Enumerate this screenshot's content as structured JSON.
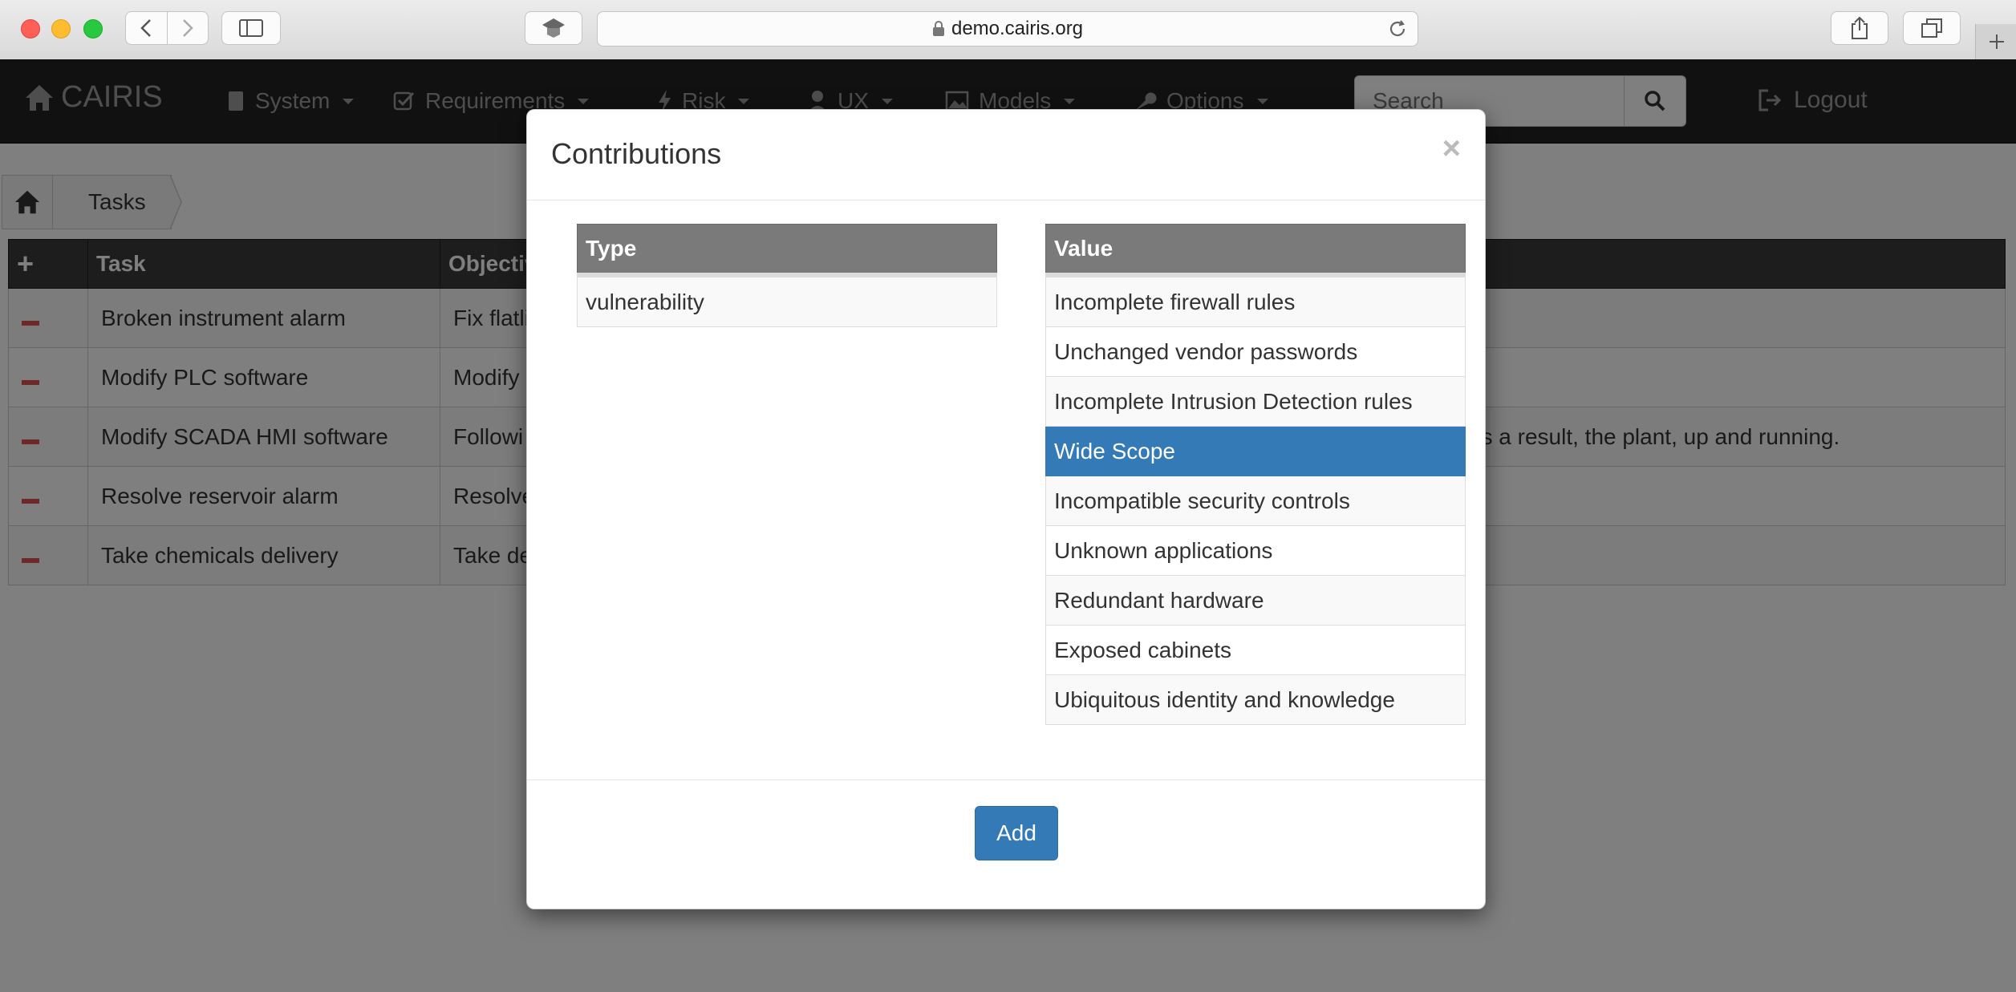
{
  "browser": {
    "url": "demo.cairis.org"
  },
  "navbar": {
    "brand": "CAIRIS",
    "menus": [
      "System",
      "Requirements",
      "Risk",
      "UX",
      "Models",
      "Options"
    ],
    "search_placeholder": "Search",
    "logout": "Logout"
  },
  "breadcrumb": {
    "current": "Tasks"
  },
  "tasks_table": {
    "headers": [
      "Task",
      "Objective"
    ],
    "rows": [
      {
        "task": "Broken instrument alarm",
        "objective": "Fix flatli"
      },
      {
        "task": "Modify PLC software",
        "objective": "Modify"
      },
      {
        "task": "Modify SCADA HMI software",
        "objective": "Followi",
        "objective_tail": "s a result, the plant, up and running."
      },
      {
        "task": "Resolve reservoir alarm",
        "objective": "Resolve"
      },
      {
        "task": "Take chemicals delivery",
        "objective": "Take de"
      }
    ]
  },
  "modal": {
    "title": "Contributions",
    "close": "×",
    "type_header": "Type",
    "type_value": "vulnerability",
    "value_header": "Value",
    "values": [
      "Incomplete firewall rules",
      "Unchanged vendor passwords",
      "Incomplete Intrusion Detection rules",
      "Wide Scope",
      "Incompatible security controls",
      "Unknown applications",
      "Redundant hardware",
      "Exposed cabinets",
      "Ubiquitous identity and knowledge"
    ],
    "selected_value": "Wide Scope",
    "add_label": "Add"
  },
  "colors": {
    "primary": "#337ab7",
    "navbar": "#222222",
    "delete": "#d9534f"
  }
}
